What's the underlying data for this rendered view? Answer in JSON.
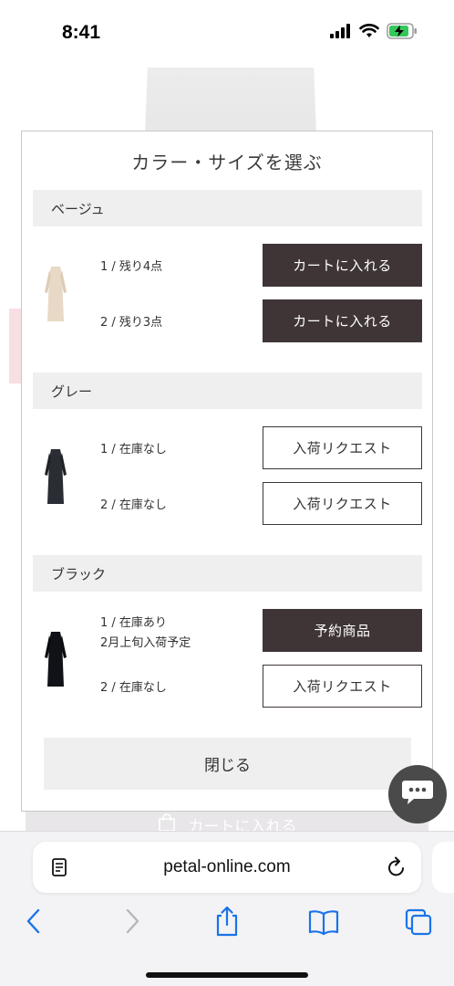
{
  "status_bar": {
    "time": "8:41",
    "icons": [
      "signal-icon",
      "wifi-icon",
      "battery-charging-icon"
    ]
  },
  "background": {
    "cart_label": "カートに入れる"
  },
  "modal": {
    "title": "カラー・サイズを選ぶ",
    "close_label": "閉じる",
    "colors": [
      {
        "name": "ベージュ",
        "thumb_color": "#e8d9c6",
        "sizes": [
          {
            "label": "1 / 残り4点",
            "button": "カートに入れる",
            "style": "dark"
          },
          {
            "label": "2 / 残り3点",
            "button": "カートに入れる",
            "style": "dark"
          }
        ]
      },
      {
        "name": "グレー",
        "thumb_color": "#2a2d33",
        "sizes": [
          {
            "label": "1 / 在庫なし",
            "button": "入荷リクエスト",
            "style": "outline"
          },
          {
            "label": "2 / 在庫なし",
            "button": "入荷リクエスト",
            "style": "outline"
          }
        ]
      },
      {
        "name": "ブラック",
        "thumb_color": "#111218",
        "sizes": [
          {
            "label": "1 / 在庫あり",
            "note": "2月上旬入荷予定",
            "button": "予約商品",
            "style": "dark"
          },
          {
            "label": "2 / 在庫なし",
            "button": "入荷リクエスト",
            "style": "outline"
          }
        ]
      }
    ]
  },
  "browser": {
    "url": "petal-online.com"
  },
  "colors": {
    "dark_button": "#3f3537",
    "header_bg": "#efefef",
    "link_blue": "#1a73e8"
  }
}
